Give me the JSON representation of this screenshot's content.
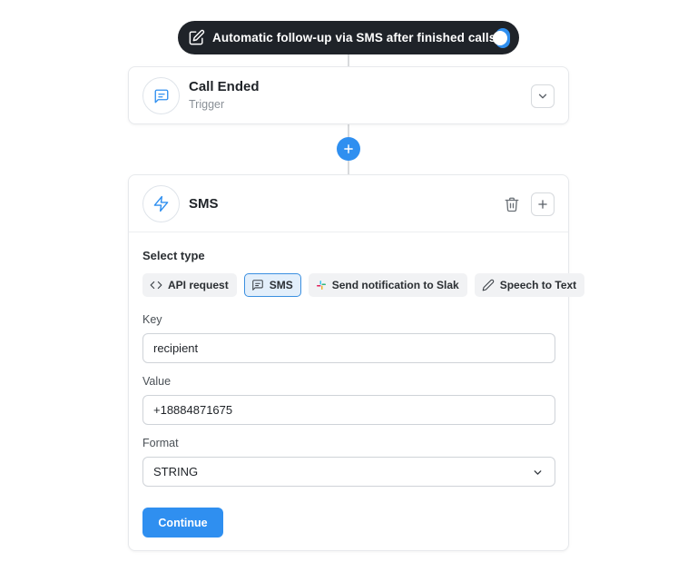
{
  "automation": {
    "title": "Automatic follow-up via SMS after finished calls",
    "enabled": true,
    "toggle_color": "#2f8ff0"
  },
  "trigger": {
    "title": "Call Ended",
    "subtitle": "Trigger",
    "icon": "message-square-icon",
    "expand_icon": "chevron-down-icon"
  },
  "add_step": {
    "icon": "plus-icon"
  },
  "action": {
    "title": "SMS",
    "icon": "zap-icon",
    "delete_icon": "trash-icon",
    "add_icon": "plus-icon",
    "select_type_label": "Select type",
    "types": [
      {
        "label": "API request",
        "icon": "code-icon",
        "selected": false
      },
      {
        "label": "SMS",
        "icon": "message-square-icon",
        "selected": true
      },
      {
        "label": "Send notification to Slak",
        "icon": "slack-icon",
        "selected": false
      },
      {
        "label": "Speech to Text",
        "icon": "pen-icon",
        "selected": false
      }
    ],
    "key": {
      "label": "Key",
      "value": "recipient"
    },
    "value": {
      "label": "Value",
      "value": "+18884871675"
    },
    "format": {
      "label": "Format",
      "value": "STRING"
    },
    "continue_label": "Continue"
  },
  "colors": {
    "accent": "#2f8ff0",
    "pill_bg": "#1f2329"
  }
}
